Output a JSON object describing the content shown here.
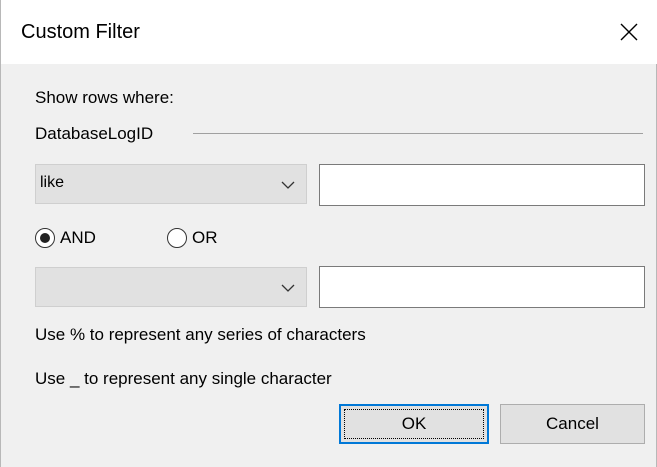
{
  "window": {
    "title": "Custom Filter",
    "close_icon": "close-icon"
  },
  "filter": {
    "intro": "Show rows where:",
    "column_name": "DatabaseLogID",
    "condition1": {
      "operator": "like",
      "value": ""
    },
    "logic": {
      "and_label": "AND",
      "or_label": "OR",
      "selected": "AND"
    },
    "condition2": {
      "operator": "",
      "value": ""
    },
    "hint_series": "Use % to represent any series of characters",
    "hint_single": "Use _ to represent any single character"
  },
  "buttons": {
    "ok_label": "OK",
    "cancel_label": "Cancel"
  },
  "colors": {
    "accent": "#0078d7",
    "dialog_bg": "#f0f0f0",
    "combo_bg": "#e1e1e1"
  }
}
